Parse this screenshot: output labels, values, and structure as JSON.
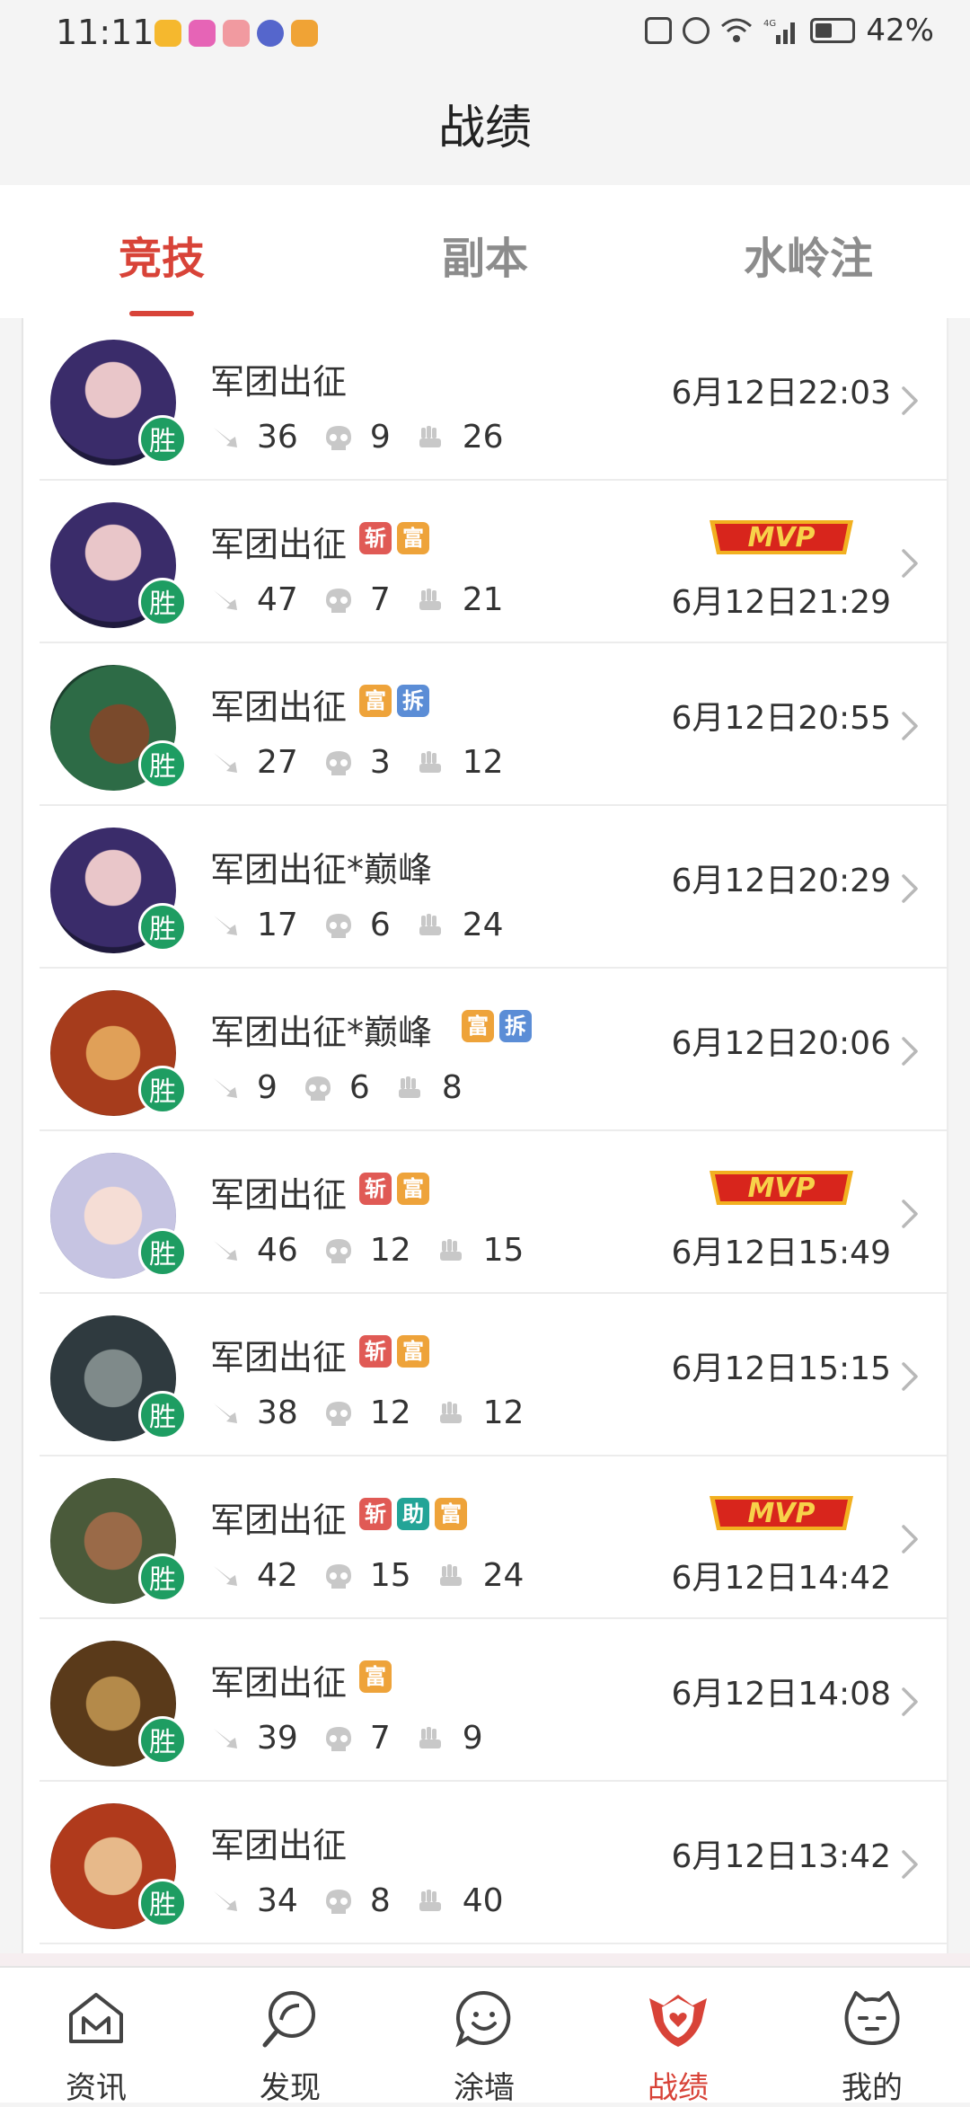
{
  "status_bar": {
    "time": "11:11",
    "battery": "42%",
    "network": "4G"
  },
  "header": {
    "title": "战绩"
  },
  "tabs": [
    {
      "label": "竞技",
      "active": true
    },
    {
      "label": "副本",
      "active": false
    },
    {
      "label": "水岭注",
      "active": false
    }
  ],
  "colors": {
    "accent": "#d84338",
    "win_green": "#1e9d62",
    "badge_red": "#e05a55",
    "badge_orange": "#eea33a",
    "badge_blue": "#5b8dd6",
    "badge_teal": "#23a497"
  },
  "records": [
    {
      "mode": "军团出征",
      "result": "胜",
      "kills": "36",
      "deaths": "9",
      "assists": "26",
      "time": "6月12日22:03",
      "badges": [],
      "mvp": false
    },
    {
      "mode": "军团出征",
      "result": "胜",
      "kills": "47",
      "deaths": "7",
      "assists": "21",
      "time": "6月12日21:29",
      "badges": [
        {
          "text": "斩",
          "color": "#e05a55"
        },
        {
          "text": "富",
          "color": "#eea33a"
        }
      ],
      "mvp": true
    },
    {
      "mode": "军团出征",
      "result": "胜",
      "kills": "27",
      "deaths": "3",
      "assists": "12",
      "time": "6月12日20:55",
      "badges": [
        {
          "text": "富",
          "color": "#eea33a"
        },
        {
          "text": "拆",
          "color": "#5b8dd6"
        }
      ],
      "mvp": false
    },
    {
      "mode": "军团出征*巅峰",
      "result": "胜",
      "kills": "17",
      "deaths": "6",
      "assists": "24",
      "time": "6月12日20:29",
      "badges": [],
      "mvp": false
    },
    {
      "mode": "军团出征*巅峰",
      "result": "胜",
      "kills": "9",
      "deaths": "6",
      "assists": "8",
      "time": "6月12日20:06",
      "badges": [
        {
          "text": "富",
          "color": "#eea33a"
        },
        {
          "text": "拆",
          "color": "#5b8dd6"
        }
      ],
      "mvp": false
    },
    {
      "mode": "军团出征",
      "result": "胜",
      "kills": "46",
      "deaths": "12",
      "assists": "15",
      "time": "6月12日15:49",
      "badges": [
        {
          "text": "斩",
          "color": "#e05a55"
        },
        {
          "text": "富",
          "color": "#eea33a"
        }
      ],
      "mvp": true
    },
    {
      "mode": "军团出征",
      "result": "胜",
      "kills": "38",
      "deaths": "12",
      "assists": "12",
      "time": "6月12日15:15",
      "badges": [
        {
          "text": "斩",
          "color": "#e05a55"
        },
        {
          "text": "富",
          "color": "#eea33a"
        }
      ],
      "mvp": false
    },
    {
      "mode": "军团出征",
      "result": "胜",
      "kills": "42",
      "deaths": "15",
      "assists": "24",
      "time": "6月12日14:42",
      "badges": [
        {
          "text": "斩",
          "color": "#e05a55"
        },
        {
          "text": "助",
          "color": "#23a497"
        },
        {
          "text": "富",
          "color": "#eea33a"
        }
      ],
      "mvp": true
    },
    {
      "mode": "军团出征",
      "result": "胜",
      "kills": "39",
      "deaths": "7",
      "assists": "9",
      "time": "6月12日14:08",
      "badges": [
        {
          "text": "富",
          "color": "#eea33a"
        }
      ],
      "mvp": false
    },
    {
      "mode": "军团出征",
      "result": "胜",
      "kills": "34",
      "deaths": "8",
      "assists": "40",
      "time": "6月12日13:42",
      "badges": [],
      "mvp": false
    }
  ],
  "mvp_label": "MVP",
  "bottom_nav": [
    {
      "label": "资讯",
      "icon": "home-m-icon",
      "active": false
    },
    {
      "label": "发现",
      "icon": "discover-icon",
      "active": false
    },
    {
      "label": "涂墙",
      "icon": "smile-chat-icon",
      "active": false
    },
    {
      "label": "战绩",
      "icon": "shield-icon",
      "active": true
    },
    {
      "label": "我的",
      "icon": "profile-face-icon",
      "active": false
    }
  ]
}
